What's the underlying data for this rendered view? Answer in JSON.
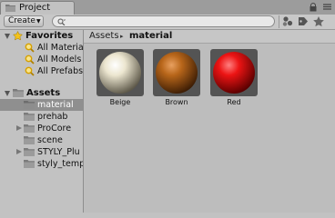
{
  "window": {
    "tab_title": "Project"
  },
  "toolbar": {
    "create_label": "Create",
    "search_placeholder": ""
  },
  "favorites": {
    "header": "Favorites",
    "items": [
      "All Materia",
      "All Models",
      "All Prefabs"
    ]
  },
  "assets_tree": {
    "header": "Assets",
    "items": [
      "material",
      "prehab",
      "ProCore",
      "scene",
      "STYLY_Plu",
      "styly_temp"
    ]
  },
  "breadcrumb": {
    "root": "Assets",
    "separator": "▸",
    "current": "material"
  },
  "assets": [
    {
      "name": "Beige",
      "color": "#e8e2cc"
    },
    {
      "name": "Brown",
      "color": "#b8661a"
    },
    {
      "name": "Red",
      "color": "#e81414"
    }
  ]
}
